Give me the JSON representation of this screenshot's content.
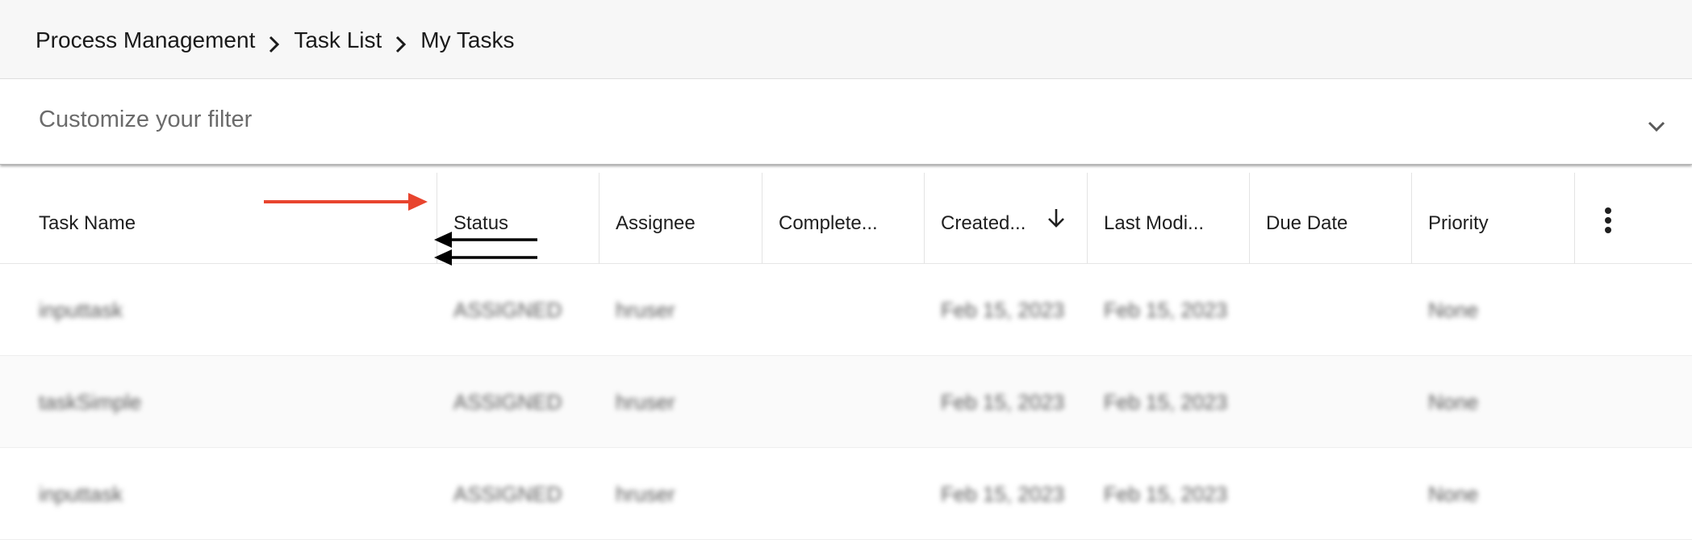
{
  "header": {
    "breadcrumb": [
      "Process Management",
      "Task List",
      "My Tasks"
    ]
  },
  "filter": {
    "placeholder": "Customize your filter",
    "expand_icon": "chevron-down-icon"
  },
  "table": {
    "columns": [
      {
        "label": "Task Name"
      },
      {
        "label": "Status"
      },
      {
        "label": "Assignee"
      },
      {
        "label": "Complete..."
      },
      {
        "label": "Created...",
        "sort": "descending",
        "sort_icon": "arrow-down-icon"
      },
      {
        "label": "Last Modi..."
      },
      {
        "label": "Due Date"
      },
      {
        "label": "Priority"
      }
    ],
    "menu_icon": "more-vertical-icon",
    "rows": [
      {
        "task_name": "inputtask",
        "status": "ASSIGNED",
        "assignee": "hruser",
        "completed": "",
        "created": "Feb 15, 2023",
        "last_modified": "Feb 15, 2023",
        "due_date": "",
        "priority": "None"
      },
      {
        "task_name": "taskSimple",
        "status": "ASSIGNED",
        "assignee": "hruser",
        "completed": "",
        "created": "Feb 15, 2023",
        "last_modified": "Feb 15, 2023",
        "due_date": "",
        "priority": "None"
      },
      {
        "task_name": "inputtask",
        "status": "ASSIGNED",
        "assignee": "hruser",
        "completed": "",
        "created": "Feb 15, 2023",
        "last_modified": "Feb 15, 2023",
        "due_date": "",
        "priority": "None"
      }
    ]
  },
  "annotations": {
    "red_arrow_color": "#e8442e",
    "black_arrow_color": "#000000"
  }
}
